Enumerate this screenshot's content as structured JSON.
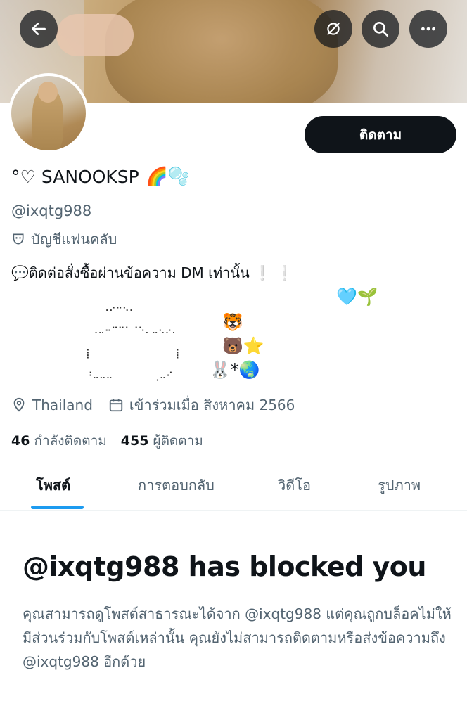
{
  "header": {
    "back_icon": "arrow-left-icon",
    "actions": [
      "no-notify-icon",
      "search-icon",
      "more-icon"
    ]
  },
  "profile": {
    "follow_label": "ติดตาม",
    "name_prefix": "°♡",
    "name": "SANOOKSP",
    "name_emoji": "🌈🫧",
    "handle": "@ixqtg988",
    "fan_account": "บัญชีแฟนคลับ",
    "bio_line1": "ติดต่อสั่งซื้อผ่านข้อความ DM เท่านั้น",
    "bio_line1_emoji_pre": "💬",
    "bio_line1_emoji_post": "❕ ❕",
    "bio_line2_emoji": "🩵🌱",
    "ascii_art": "   ⠠⠔⠒⠢⠄\n ⠠⠤⠒⠉⠉⠁⠈⠑⠄⠤⠢⠔⠄\n⡇⠀⠀⠀⠀⠀⠀⠀⠀⠀⠀⠀⠀⢸\n⠘⠤⠤⠤⠀⠀⠀⠀⠀⠀⢀⠤⠊",
    "ascii_emoji": [
      "🐯",
      "🐻⭐",
      "🐰*🌏"
    ],
    "location": "Thailand",
    "joined": "เข้าร่วมเมื่อ สิงหาคม 2566",
    "following_count": "46",
    "following_label": "กำลังติดตาม",
    "followers_count": "455",
    "followers_label": "ผู้ติดตาม"
  },
  "tabs": [
    "โพสต์",
    "การตอบกลับ",
    "วิดีโอ",
    "รูปภาพ"
  ],
  "blocked": {
    "title": "@ixqtg988 has blocked you",
    "message": "คุณสามารถดูโพสต์สาธารณะได้จาก @ixqtg988 แต่คุณถูกบล็อคไม่ให้มีส่วนร่วมกับโพสต์เหล่านั้น คุณยังไม่สามารถติดตามหรือส่งข้อความถึง @ixqtg988 อีกด้วย"
  },
  "colors": {
    "accent": "#1d9bf0",
    "text": "#0f1419",
    "muted": "#536471"
  }
}
